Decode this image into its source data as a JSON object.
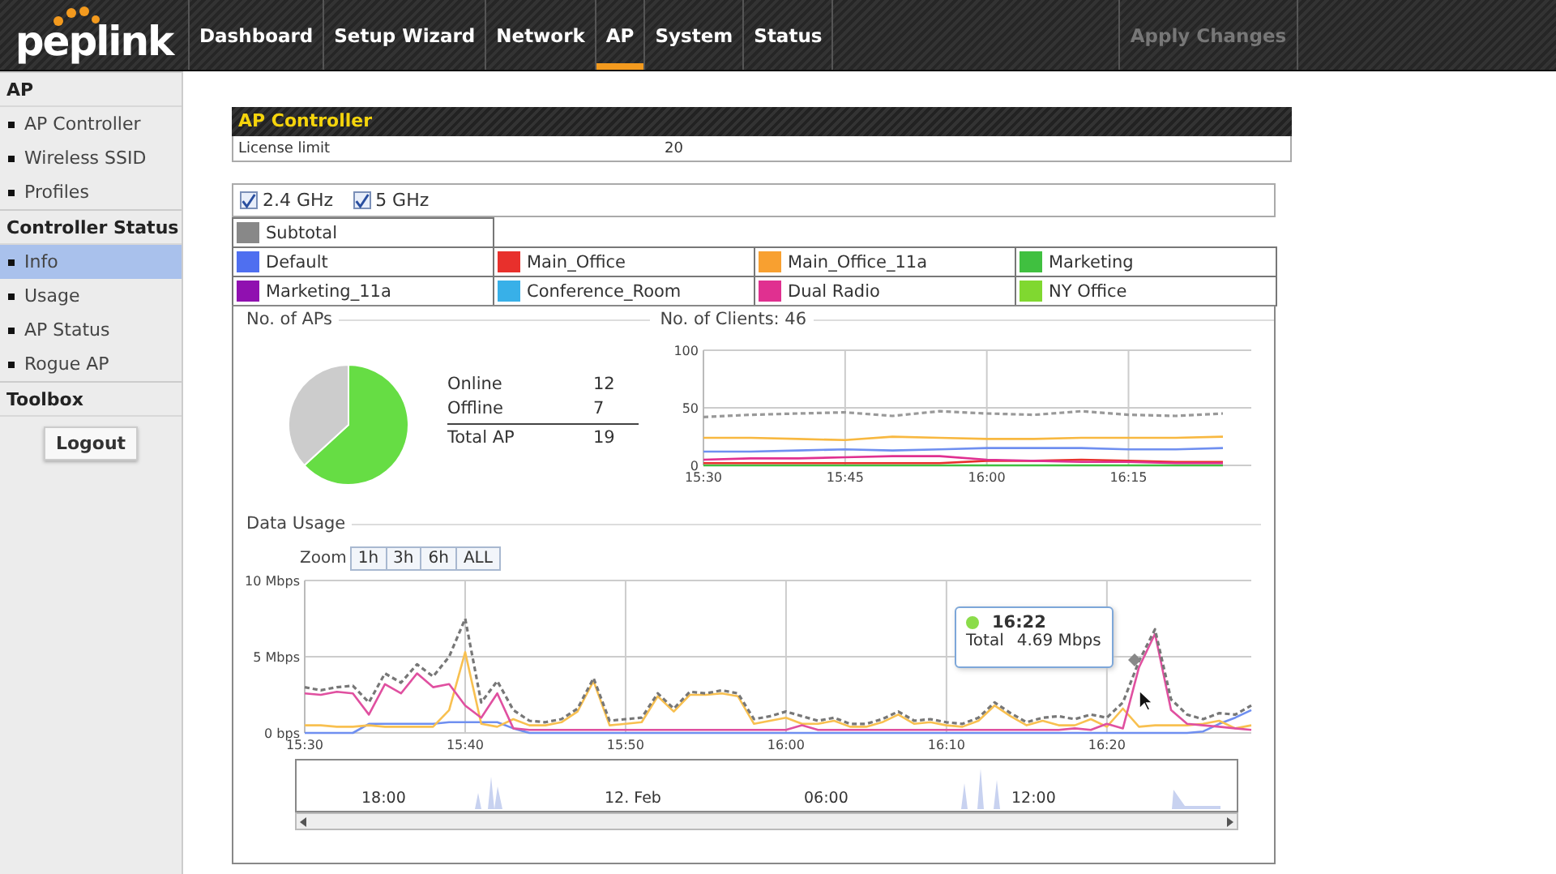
{
  "logo": "peplink",
  "nav": {
    "tabs": [
      {
        "label": "Dashboard",
        "selected": false
      },
      {
        "label": "Setup Wizard",
        "selected": false
      },
      {
        "label": "Network",
        "selected": false
      },
      {
        "label": "AP",
        "selected": true
      },
      {
        "label": "System",
        "selected": false
      },
      {
        "label": "Status",
        "selected": false
      }
    ],
    "apply": {
      "label": "Apply Changes",
      "disabled": true
    }
  },
  "sidebar": {
    "sections": [
      {
        "title": "AP",
        "items": [
          {
            "label": "AP Controller",
            "selected": false
          },
          {
            "label": "Wireless SSID",
            "selected": false
          },
          {
            "label": "Profiles",
            "selected": false
          }
        ]
      },
      {
        "title": "Controller Status",
        "items": [
          {
            "label": "Info",
            "selected": true
          },
          {
            "label": "Usage",
            "selected": false
          },
          {
            "label": "AP Status",
            "selected": false
          },
          {
            "label": "Rogue AP",
            "selected": false
          }
        ]
      },
      {
        "title": "Toolbox"
      }
    ],
    "logout": "Logout"
  },
  "controller": {
    "title": "AP Controller",
    "license_label": "License limit",
    "license_value": "20"
  },
  "bands": [
    {
      "label": "2.4 GHz",
      "checked": true
    },
    {
      "label": "5 GHz",
      "checked": true
    }
  ],
  "legend": [
    {
      "label": "Subtotal",
      "color": "#888888"
    },
    {
      "label": "Default",
      "color": "#4f6ff0"
    },
    {
      "label": "Main_Office",
      "color": "#e8302c"
    },
    {
      "label": "Main_Office_11a",
      "color": "#f8a030"
    },
    {
      "label": "Marketing",
      "color": "#40c040"
    },
    {
      "label": "Marketing_11a",
      "color": "#9010b0"
    },
    {
      "label": "Conference_Room",
      "color": "#38b0e8"
    },
    {
      "label": "Dual Radio",
      "color": "#e03090"
    },
    {
      "label": "NY Office",
      "color": "#80d830"
    }
  ],
  "aps": {
    "title": "No. of APs",
    "chart_data": {
      "type": "pie",
      "values": [
        63.2,
        36.8
      ]
    },
    "rows": [
      {
        "label": "Online",
        "value": "12"
      },
      {
        "label": "Offline",
        "value": "7"
      },
      {
        "label": "Total AP",
        "value": "19"
      }
    ]
  },
  "clients": {
    "title": "No. of Clients: 46",
    "chart_data": {
      "type": "line",
      "grid": true,
      "categories": [
        "15:30",
        null,
        null,
        "15:45",
        null,
        null,
        "16:00",
        null,
        null,
        "16:15",
        null,
        null
      ],
      "ylim": [
        0,
        100
      ],
      "yticks": [
        0,
        50,
        100
      ],
      "series": [
        {
          "color": "#999999",
          "line_style": "dashed",
          "values": [
            42,
            44,
            45,
            46,
            43,
            47,
            45,
            44,
            47,
            44,
            43,
            45
          ]
        },
        {
          "color": "#f8b840",
          "values": [
            24,
            24,
            23,
            22,
            25,
            24,
            23,
            23,
            24,
            24,
            24,
            25
          ]
        },
        {
          "color": "#6f8ff0",
          "values": [
            12,
            12,
            13,
            14,
            13,
            14,
            15,
            15,
            15,
            14,
            14,
            15
          ]
        },
        {
          "color": "#e03090",
          "values": [
            5,
            6,
            6,
            7,
            8,
            8,
            5,
            4,
            3,
            3,
            2,
            2
          ]
        },
        {
          "color": "#e8302c",
          "values": [
            2,
            2,
            2,
            2,
            2,
            2,
            4,
            4,
            5,
            4,
            3,
            3
          ]
        },
        {
          "color": "#40c040",
          "values": [
            0,
            0,
            0,
            0,
            0,
            0,
            0,
            0,
            0,
            0,
            0,
            0
          ]
        }
      ]
    }
  },
  "usage": {
    "title": "Data Usage",
    "zoom_label": "Zoom",
    "zoom_buttons": [
      "1h",
      "3h",
      "6h",
      "ALL"
    ],
    "chart_data": {
      "type": "line",
      "categories": [
        "15:30",
        null,
        null,
        null,
        null,
        null,
        null,
        null,
        null,
        null,
        "15:40",
        null,
        null,
        null,
        null,
        null,
        null,
        null,
        null,
        null,
        "15:50",
        null,
        null,
        null,
        null,
        null,
        null,
        null,
        null,
        null,
        "16:00",
        null,
        null,
        null,
        null,
        null,
        null,
        null,
        null,
        null,
        "16:10",
        null,
        null,
        null,
        null,
        null,
        null,
        null,
        null,
        null,
        "16:20",
        null,
        null,
        null,
        null,
        null,
        null,
        null,
        null,
        null
      ],
      "ylim": [
        0,
        10
      ],
      "grid": true,
      "yticks": [
        {
          "value": 0,
          "label": "0 bps"
        },
        {
          "value": 5,
          "label": "5 Mbps"
        },
        {
          "value": 10,
          "label": "10 Mbps"
        }
      ],
      "series": [
        {
          "color": "#777777",
          "line_style": "dashed",
          "values": [
            3.0,
            2.8,
            3.0,
            3.1,
            2.0,
            3.9,
            3.3,
            4.5,
            3.7,
            5.0,
            7.5,
            2.0,
            3.4,
            1.5,
            0.8,
            0.7,
            0.9,
            1.6,
            3.6,
            0.8,
            0.9,
            1.0,
            2.6,
            1.6,
            2.7,
            2.6,
            2.8,
            2.6,
            0.9,
            1.1,
            1.4,
            1.1,
            0.8,
            1.0,
            0.6,
            0.6,
            0.9,
            1.4,
            0.8,
            0.9,
            0.7,
            0.6,
            1.0,
            2.0,
            1.3,
            0.7,
            1.0,
            1.1,
            0.9,
            1.2,
            1.0,
            2.0,
            4.7,
            6.8,
            2.2,
            1.2,
            0.9,
            1.3,
            1.2,
            1.8
          ]
        },
        {
          "color": "#e050a0",
          "values": [
            2.6,
            2.5,
            2.7,
            2.6,
            1.2,
            3.2,
            2.6,
            3.9,
            3.0,
            3.2,
            1.8,
            1.0,
            2.6,
            0.3,
            0.2,
            0.2,
            0.2,
            0.2,
            0.2,
            0.2,
            0.2,
            0.2,
            0.2,
            0.2,
            0.2,
            0.2,
            0.2,
            0.2,
            0.2,
            0.2,
            0.2,
            0.5,
            0.2,
            0.2,
            0.2,
            0.2,
            0.2,
            0.2,
            0.2,
            0.2,
            0.2,
            0.2,
            0.2,
            0.2,
            0.2,
            0.2,
            0.2,
            0.2,
            0.3,
            0.2,
            0.6,
            0.3,
            4.3,
            6.5,
            1.5,
            0.6,
            0.5,
            0.4,
            0.3,
            0.2
          ]
        },
        {
          "color": "#f8c050",
          "values": [
            0.5,
            0.5,
            0.4,
            0.4,
            0.5,
            0.4,
            0.4,
            0.4,
            0.4,
            1.5,
            5.3,
            0.6,
            0.4,
            0.9,
            0.5,
            0.5,
            0.7,
            1.4,
            3.4,
            0.5,
            0.6,
            0.7,
            2.4,
            1.4,
            2.5,
            2.5,
            2.6,
            2.4,
            0.6,
            0.8,
            1.0,
            0.6,
            0.6,
            0.8,
            0.4,
            0.4,
            0.7,
            1.2,
            0.6,
            0.7,
            0.5,
            0.4,
            0.8,
            1.8,
            1.1,
            0.5,
            0.8,
            0.5,
            0.5,
            0.9,
            0.4,
            1.6,
            0.4,
            0.5,
            0.5,
            0.5,
            0.6,
            0.8,
            0.3,
            0.5
          ]
        },
        {
          "color": "#6f8ff0",
          "values": [
            0,
            0,
            0,
            0,
            0.6,
            0.6,
            0.6,
            0.6,
            0.6,
            0.7,
            0.7,
            0.7,
            0.7,
            0.3,
            0,
            0,
            0,
            0,
            0,
            0,
            0,
            0,
            0,
            0,
            0,
            0,
            0,
            0,
            0,
            0,
            0,
            0,
            0,
            0,
            0,
            0,
            0,
            0,
            0,
            0,
            0,
            0,
            0,
            0,
            0,
            0,
            0,
            0,
            0,
            0,
            0,
            0,
            0,
            0,
            0,
            0,
            0.1,
            0.6,
            1.0,
            1.5
          ]
        }
      ]
    },
    "tooltip": {
      "time": "16:22",
      "label": "Total",
      "value": "4.69 Mbps"
    },
    "navigator": {
      "labels": [
        "18:00",
        "12. Feb",
        "06:00",
        "12:00"
      ]
    }
  }
}
